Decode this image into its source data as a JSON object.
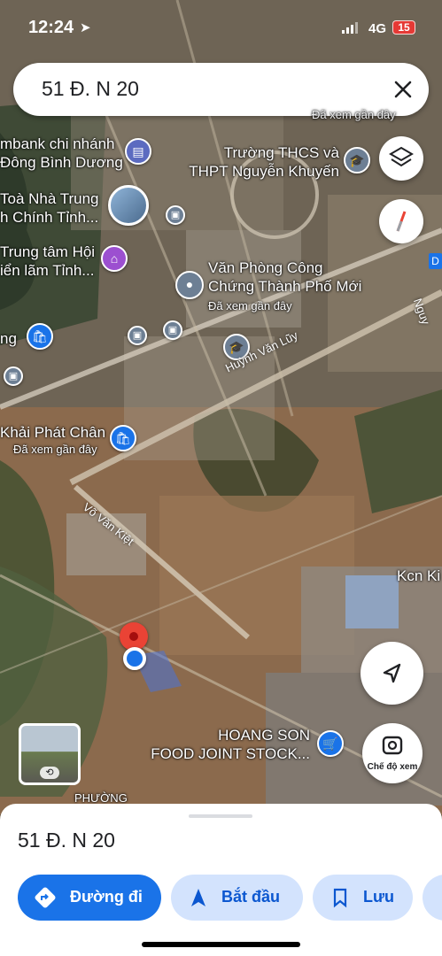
{
  "status_bar": {
    "time": "12:24",
    "network": "4G",
    "battery": "15"
  },
  "search": {
    "query": "51 Đ. N 20",
    "clear_icon": "close-icon"
  },
  "map_controls": {
    "layers_icon": "layers-icon",
    "compass_icon": "compass-icon",
    "location_icon": "my-location-icon"
  },
  "lens": {
    "label": "Chế độ xem",
    "icon": "camera-lens-icon"
  },
  "street_view": {
    "icon": "street-view-rotate-icon"
  },
  "places": [
    {
      "name": "mbank chi nhánh",
      "name2": "Đông Bình Dương",
      "icon": "atm-icon"
    },
    {
      "name": "Trường THCS và",
      "name2": "THPT Nguyễn Khuyến",
      "icon": "school-icon"
    },
    {
      "name": "Toà Nhà Trung",
      "name2": "h Chính Tỉnh..."
    },
    {
      "name": "Trung tâm Hội",
      "name2": "iển lãm Tỉnh...",
      "icon": "venue-icon"
    },
    {
      "name": "Văn Phòng Công",
      "name2": "Chứng Thành Phố Mới",
      "note": "Đã xem gần đây",
      "icon": "place-icon"
    },
    {
      "name": "ng",
      "icon": "shopping-icon"
    },
    {
      "name": "Khải Phát Chân",
      "note": "Đã xem gần đây",
      "icon": "shopping-icon"
    },
    {
      "name": "HOANG SON",
      "name2": "FOOD JOINT STOCK...",
      "icon": "shopping-icon"
    },
    {
      "name": "Kcn Ki"
    },
    {
      "name": "PHƯỜNG"
    }
  ],
  "top_note": "Đã xem gần đây",
  "roads": [
    "Huỳnh Văn Lũy",
    "Võ Văn Kiệt"
  ],
  "marker_labels": [
    "D",
    "Nguy"
  ],
  "sheet": {
    "title": "51 Đ. N 20",
    "buttons": {
      "directions": "Đường đi",
      "start": "Bắt đầu",
      "save": "Lưu"
    }
  },
  "colors": {
    "primary": "#1a73e8",
    "chip_bg": "#d3e3fd",
    "chip_text": "#0b57d0",
    "pin_red": "#ea4335"
  }
}
